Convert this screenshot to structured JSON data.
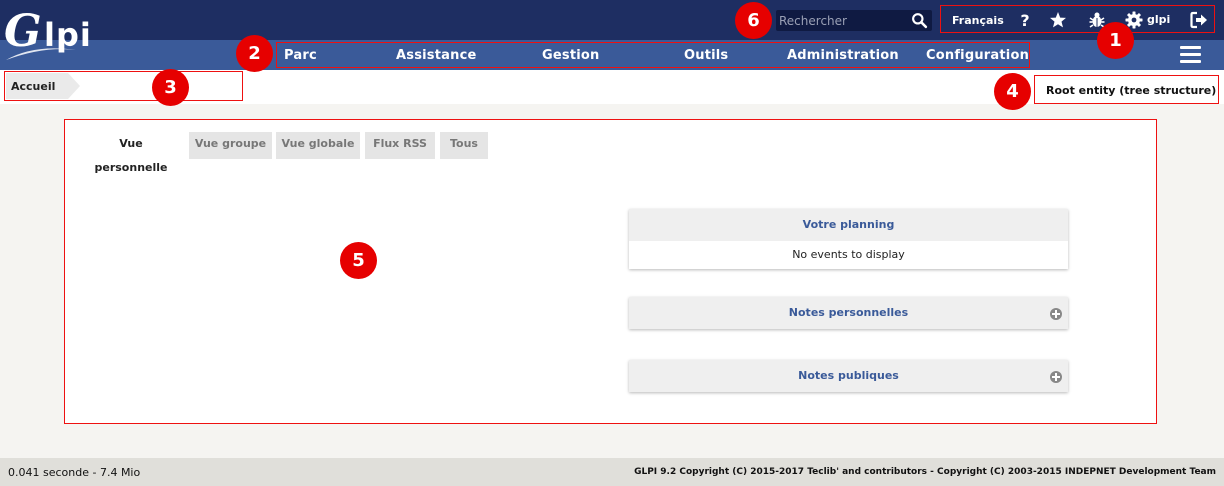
{
  "app": {
    "logo_text": "Glpi"
  },
  "search": {
    "placeholder": "Rechercher"
  },
  "top_menu": {
    "language": "Français",
    "icons": [
      "help-icon",
      "star-icon",
      "bug-icon",
      "gear-icon",
      "logout-icon"
    ],
    "user": "glpi"
  },
  "nav": {
    "items": [
      "Parc",
      "Assistance",
      "Gestion",
      "Outils",
      "Administration",
      "Configuration"
    ]
  },
  "breadcrumb": {
    "home": "Accueil"
  },
  "entity": {
    "label": "Root entity (tree structure)"
  },
  "tabs": [
    {
      "label": "Vue personnelle",
      "active": true
    },
    {
      "label": "Vue groupe",
      "active": false
    },
    {
      "label": "Vue globale",
      "active": false
    },
    {
      "label": "Flux RSS",
      "active": false
    },
    {
      "label": "Tous",
      "active": false
    }
  ],
  "cards": {
    "planning": {
      "title": "Votre planning",
      "body": "No events to display"
    },
    "personal_notes": {
      "title": "Notes personnelles"
    },
    "public_notes": {
      "title": "Notes publiques"
    }
  },
  "markers": [
    "1",
    "2",
    "3",
    "4",
    "5",
    "6"
  ],
  "footer": {
    "timing": "0.041 seconde - 7.4 Mio",
    "copyright": "GLPI 9.2 Copyright (C) 2015-2017 Teclib' and contributors - Copyright (C) 2003-2015 INDEPNET Development Team"
  },
  "colors": {
    "header_dark": "#1e2e62",
    "nav_blue": "#3a5a99",
    "marker_red": "#e60000",
    "card_title": "#3a5a99"
  }
}
